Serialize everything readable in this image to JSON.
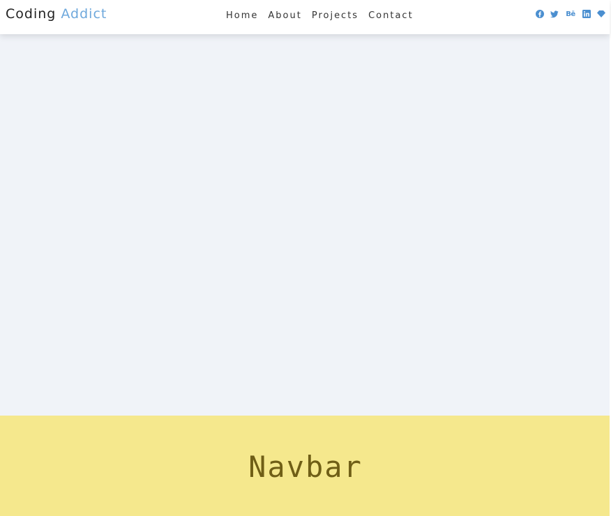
{
  "header": {
    "logo_primary": "Coding",
    "logo_accent": "Addict",
    "nav": [
      "Home",
      "About",
      "Projects",
      "Contact"
    ],
    "social_icons": [
      "facebook-icon",
      "twitter-icon",
      "behance-icon",
      "linkedin-icon",
      "sketch-icon"
    ],
    "behance_text": "Bē"
  },
  "hero": {
    "title": "Navbar"
  },
  "colors": {
    "accent": "#6ea8dc",
    "page_background": "#f0f3f8",
    "band": "#f5e88d",
    "band_text": "#6f5e16",
    "icon": "#4b8fd0"
  }
}
